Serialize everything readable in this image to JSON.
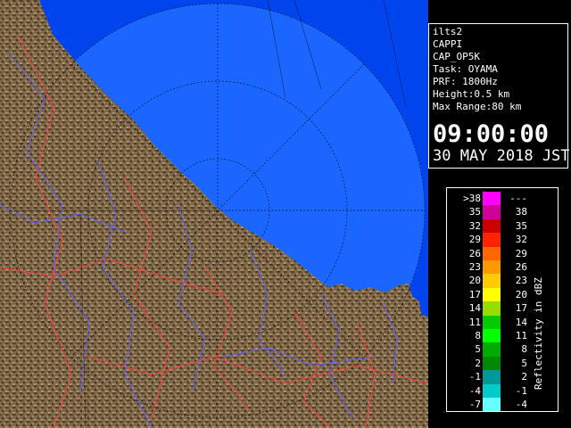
{
  "info": {
    "lines": [
      "ilts2",
      "CAPPI",
      "CAP_OP5K",
      "Task: OYAMA",
      "PRF: 1800Hz",
      "Height:0.5 km",
      "Max Range:80 km"
    ],
    "time": "09:00:00",
    "date": "30 MAY 2018 JST"
  },
  "legend": {
    "title": "Reflectivity in dBZ",
    "rows": [
      {
        "low": ">38",
        "high": "---",
        "color": "#ff00ff"
      },
      {
        "low": "35",
        "high": "38",
        "color": "#cc0099"
      },
      {
        "low": "32",
        "high": "35",
        "color": "#cc0000"
      },
      {
        "low": "29",
        "high": "32",
        "color": "#ff2200"
      },
      {
        "low": "26",
        "high": "29",
        "color": "#ff6600"
      },
      {
        "low": "23",
        "high": "26",
        "color": "#ff9900"
      },
      {
        "low": "20",
        "high": "23",
        "color": "#ffcc00"
      },
      {
        "low": "17",
        "high": "20",
        "color": "#ffff00"
      },
      {
        "low": "14",
        "high": "17",
        "color": "#99dd00"
      },
      {
        "low": "11",
        "high": "14",
        "color": "#00cc00"
      },
      {
        "low": "8",
        "high": "11",
        "color": "#00ff00"
      },
      {
        "low": "5",
        "high": "8",
        "color": "#00aa00"
      },
      {
        "low": "2",
        "high": "5",
        "color": "#008800"
      },
      {
        "low": "-1",
        "high": "2",
        "color": "#009999"
      },
      {
        "low": "-4",
        "high": "-1",
        "color": "#00cccc"
      },
      {
        "low": "-7",
        "high": "-4",
        "color": "#66ffff"
      }
    ]
  },
  "map_colors": {
    "sea": "#0044ee",
    "coverage": "#1a66ff",
    "land": "#7d6747",
    "border": "#ff4040",
    "river": "#6060ff",
    "grid": "#000000"
  }
}
